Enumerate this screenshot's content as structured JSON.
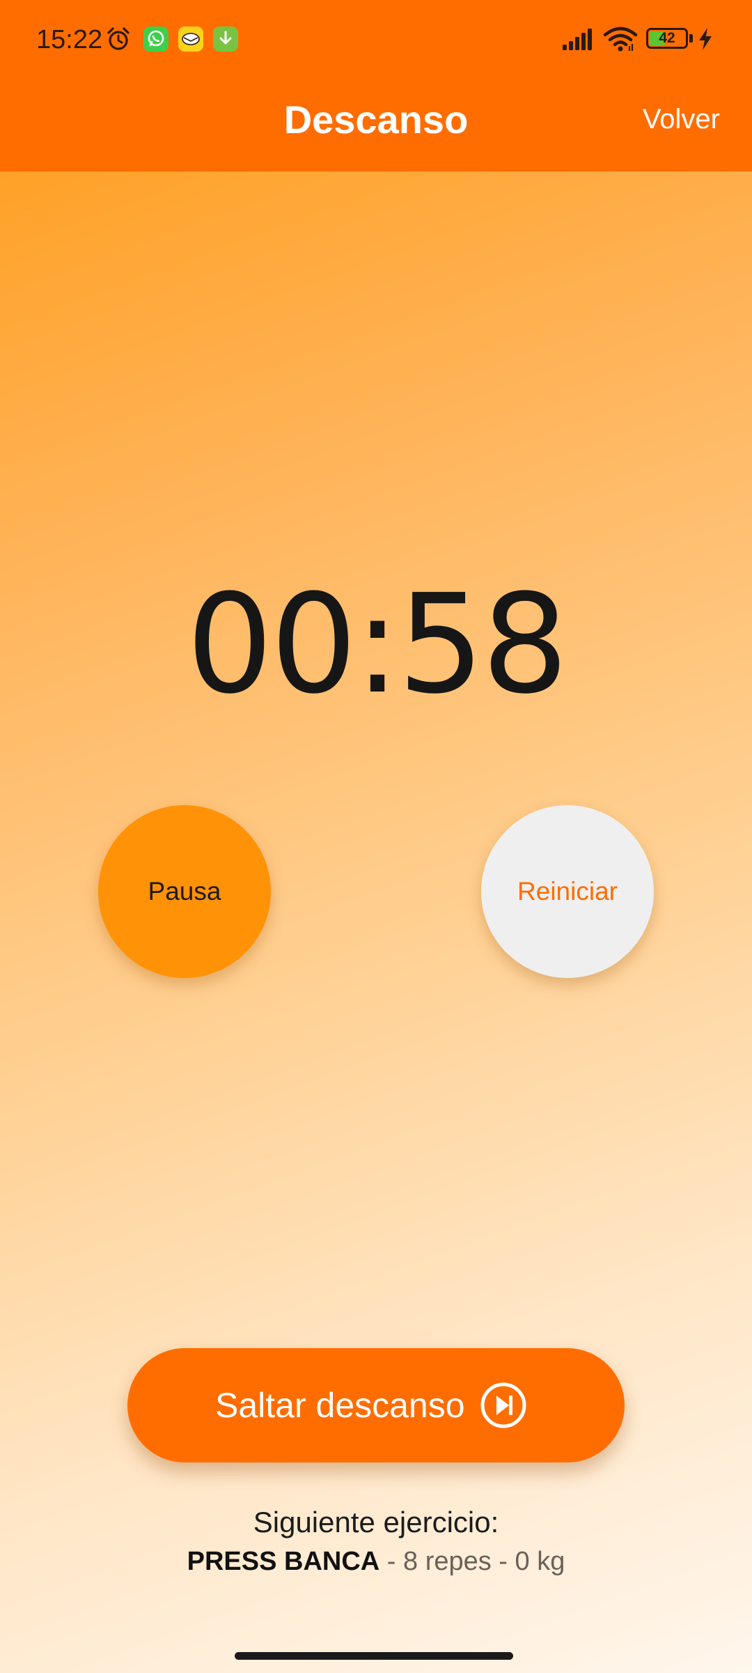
{
  "status_bar": {
    "time": "15:22",
    "battery_level": "42",
    "icons": [
      "alarm-icon",
      "whatsapp-icon",
      "mail-icon",
      "download-icon",
      "signal-icon",
      "wifi-icon",
      "battery-icon",
      "charging-bolt-icon"
    ],
    "colors": {
      "whatsapp": "#3fcf4a",
      "mail": "#f9d31a",
      "download": "#78c342",
      "battery_fill": "#5cc531"
    }
  },
  "app_bar": {
    "title": "Descanso",
    "back_label": "Volver",
    "color": "#ff6d00"
  },
  "timer": {
    "value": "00:58"
  },
  "controls": {
    "pause_label": "Pausa",
    "reset_label": "Reiniciar",
    "pause_color": "#ff9206",
    "reset_color": "#efefef"
  },
  "skip": {
    "label": "Saltar descanso",
    "icon": "skip-next-icon"
  },
  "next_exercise": {
    "heading": "Siguiente ejercicio:",
    "name": "PRESS BANCA",
    "detail": " - 8 repes - 0 kg"
  }
}
